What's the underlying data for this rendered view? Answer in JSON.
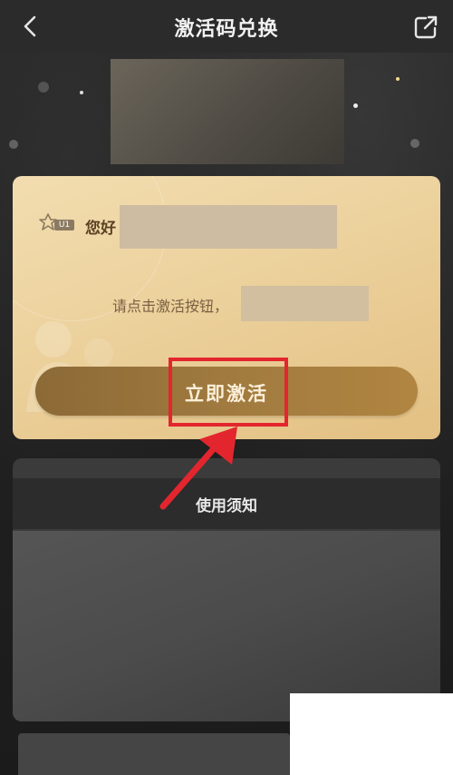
{
  "header": {
    "title": "激活码兑换",
    "back_icon": "chevron-left-icon",
    "share_icon": "share-external-icon"
  },
  "card": {
    "level_badge": "U1",
    "greeting": "您好",
    "instruction": "请点击激活按钮，",
    "activate_label": "立即激活"
  },
  "notice": {
    "title": "使用须知"
  },
  "colors": {
    "card_gold": "#ecd19c",
    "button_brown": "#a07a3f",
    "highlight_red": "#e3262e"
  }
}
